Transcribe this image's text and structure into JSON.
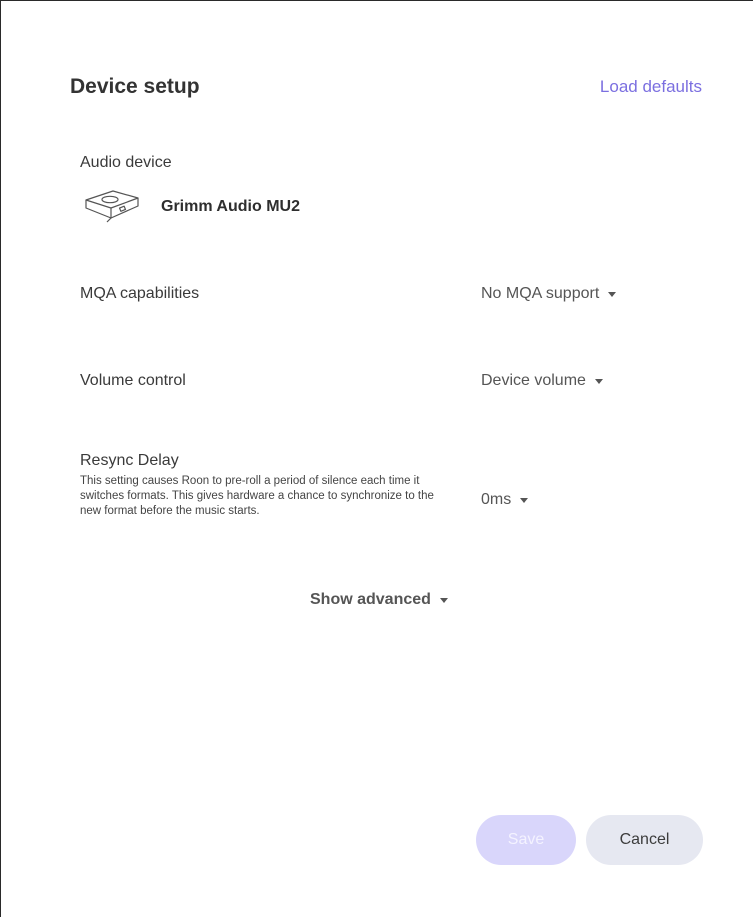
{
  "header": {
    "title": "Device setup",
    "load_defaults_label": "Load defaults"
  },
  "audio_device": {
    "label": "Audio device",
    "name": "Grimm Audio MU2",
    "icon": "audio-device-box-icon"
  },
  "settings": {
    "mqa": {
      "label": "MQA capabilities",
      "value": "No MQA support"
    },
    "volume": {
      "label": "Volume control",
      "value": "Device volume"
    },
    "resync": {
      "label": "Resync Delay",
      "description": "This setting causes Roon to pre-roll a period of silence each time it switches formats. This gives hardware a chance to synchronize to the new format before the music starts.",
      "value": "0ms"
    }
  },
  "show_advanced_label": "Show advanced",
  "footer": {
    "save_label": "Save",
    "cancel_label": "Cancel"
  },
  "colors": {
    "accent": "#7b6fe0",
    "save_button_bg": "#d9d6fb",
    "cancel_button_bg": "#e6e8f1"
  }
}
